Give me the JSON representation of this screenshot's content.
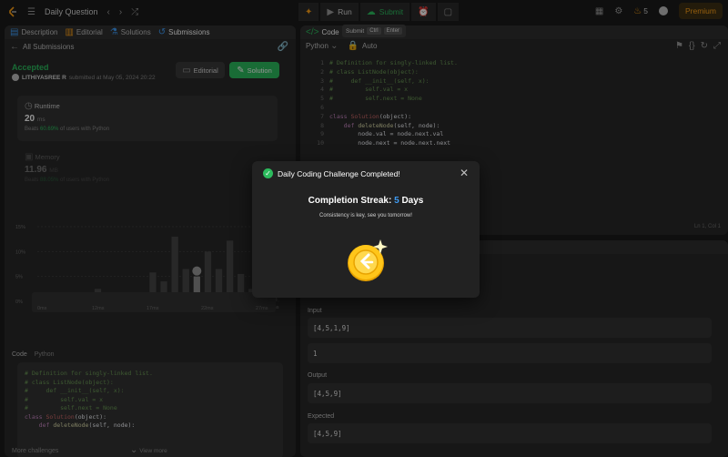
{
  "topbar": {
    "problem_list": "Daily Question",
    "run": "Run",
    "submit": "Submit",
    "streak_count": "5",
    "premium": "Premium"
  },
  "left": {
    "tabs": [
      "Description",
      "Editorial",
      "Solutions",
      "Submissions"
    ],
    "back": "All Submissions",
    "status": "Accepted",
    "user": "LITHIYASREE R",
    "submitted_text": "submitted at May 05, 2024 20:22",
    "editorial_btn": "Editorial",
    "solution_btn": "Solution",
    "runtime": {
      "title": "Runtime",
      "value": "20",
      "unit": "ms",
      "beats_pre": "Beats",
      "beats_pct": "60.69%",
      "beats_post": "of users with Python"
    },
    "memory": {
      "title": "Memory",
      "value": "11.96",
      "unit": "MB",
      "beats_pre": "Beats",
      "beats_pct": "88.05%",
      "beats_post": "of users with Python"
    },
    "chart_y": [
      "15%",
      "10%",
      "5%",
      "0%"
    ],
    "chart_x": [
      "8ms",
      "12ms",
      "17ms",
      "22ms",
      "28ms"
    ],
    "chart_x2": [
      "0ms",
      "12ms",
      "17ms",
      "22ms",
      "27ms"
    ],
    "code_label": "Code",
    "code_lang": "Python",
    "code_lines": [
      "# Definition for singly-linked list.",
      "# class ListNode(object):",
      "#     def __init__(self, x):",
      "#         self.val = x",
      "#         self.next = None",
      "",
      "class Solution(object):",
      "    def deleteNode(self, node):"
    ],
    "view_more": "View more",
    "more_challenges": "More challenges"
  },
  "editor": {
    "tab": "Code",
    "lang": "Python",
    "auto": "Auto",
    "tooltip": {
      "label": "Submit",
      "k1": "Ctrl",
      "k2": "Enter"
    },
    "lines": [
      "# Definition for singly-linked list.",
      "# class ListNode(object):",
      "#     def __init__(self, x):",
      "#         self.val = x",
      "#         self.next = None",
      "",
      "class Solution(object):",
      "    def deleteNode(self, node):",
      "        node.val = node.next.val",
      "        node.next = node.next.next"
    ],
    "position": "Ln 1, Col 1"
  },
  "testcase": {
    "input_label": "Input",
    "input_head": "[4,5,1,9]",
    "input_node": "1",
    "output_label": "Output",
    "output": "[4,5,9]",
    "expected_label": "Expected",
    "expected": "[4,5,9]"
  },
  "modal": {
    "title": "Daily Coding Challenge Completed!",
    "streak_pre": "Completion Streak:",
    "streak_num": "5",
    "streak_post": "Days",
    "message": "Consistency is key, see you tomorrow!"
  },
  "chart_data": {
    "type": "bar",
    "categories": [
      "8ms",
      "",
      "",
      "",
      "",
      "12ms",
      "",
      "",
      "",
      "",
      "17ms",
      "",
      "",
      "",
      "",
      "22ms",
      "",
      "",
      "",
      "",
      "",
      "28ms"
    ],
    "values": [
      0.2,
      0.3,
      0.4,
      0.3,
      0.6,
      2.5,
      1.0,
      0.8,
      1.2,
      1.5,
      5.8,
      4.0,
      13.0,
      6.5,
      5.0,
      10.0,
      6.5,
      12.2,
      5.5,
      2.5,
      4.5,
      1.8
    ],
    "highlight_index": 14,
    "ylim": [
      0,
      15
    ],
    "title": "",
    "xlabel": "",
    "ylabel": ""
  },
  "colors": {
    "accent": "#2cbb5d",
    "brand": "#ffa116",
    "streak": "#3e9cf5"
  }
}
